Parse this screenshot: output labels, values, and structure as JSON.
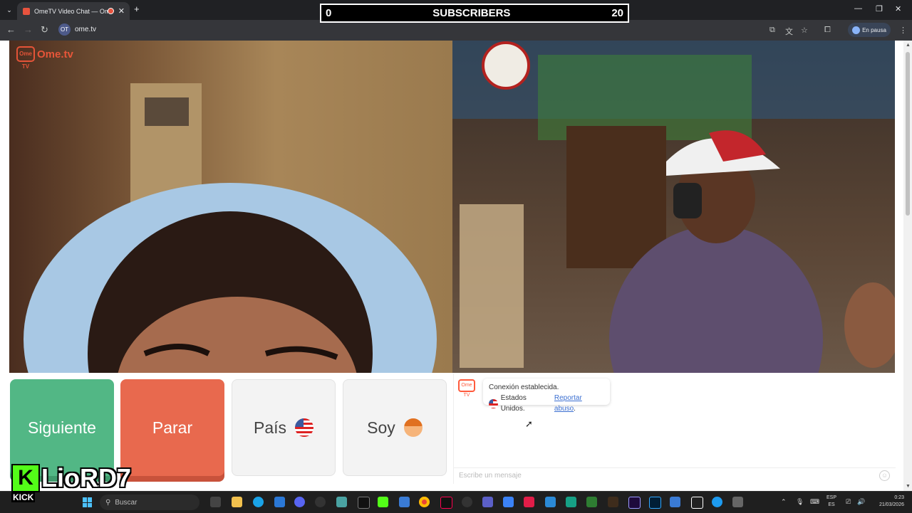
{
  "browser": {
    "tab_title": "OmeTV Video Chat — Ome",
    "url": "ome.tv",
    "site_icon": "OT",
    "profile_status": "En pausa"
  },
  "overlay_subs": {
    "left": "0",
    "label": "SUBSCRIBERS",
    "right": "20"
  },
  "video": {
    "logo_text": "Ome.tv",
    "logo_badge": "Ome TV"
  },
  "controls": {
    "next": "Siguiente",
    "stop": "Parar",
    "country": "País",
    "gender": "Soy"
  },
  "chat": {
    "line1": "Conexión establecida.",
    "country_text": "Estados Unidos.",
    "report_link": "Reportar abuso",
    "period": ".",
    "input_placeholder": "Escribe un mensaje"
  },
  "streamer": {
    "logo_letter": "K",
    "name": "LioRD7",
    "platform": "KICK"
  },
  "taskbar": {
    "search_placeholder": "Buscar",
    "lang_line1": "ESP",
    "lang_line2": "ES",
    "time": "0:23",
    "date": "21/03/2026"
  },
  "colors": {
    "next": "#52b785",
    "stop": "#e8694e",
    "brand": "#ff5a3c",
    "kick": "#53fc18"
  }
}
